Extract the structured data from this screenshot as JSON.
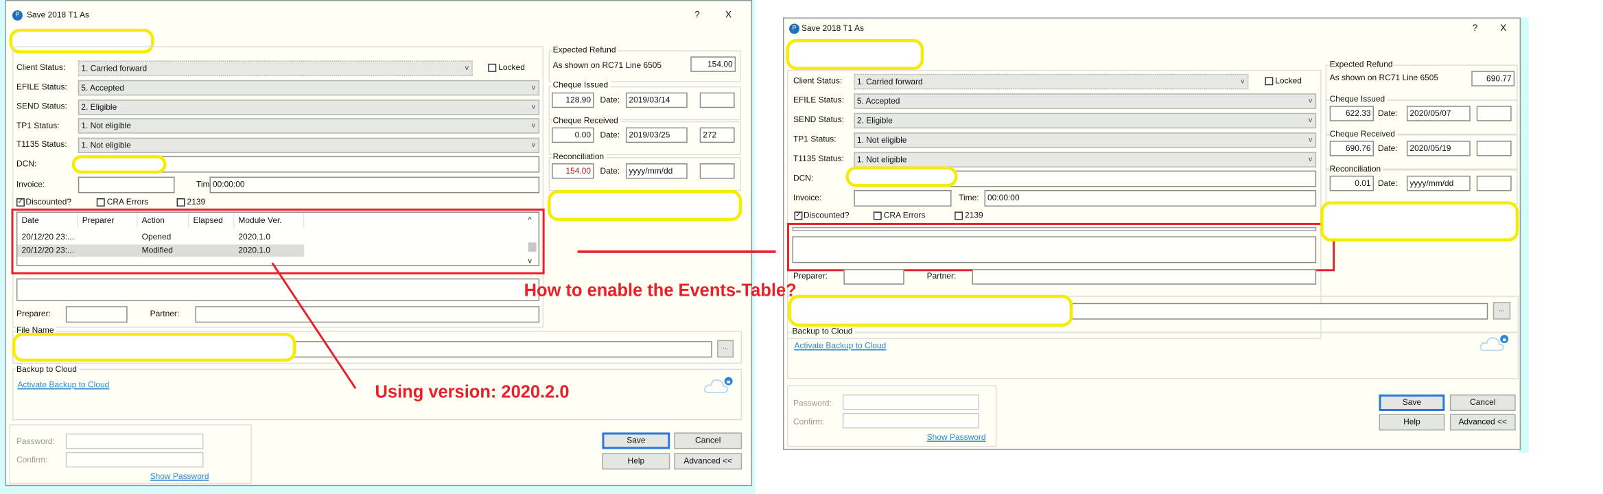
{
  "left_dialog": {
    "title": "Save 2018 T1 As",
    "help": "?",
    "close": "X",
    "client_status": {
      "label": "Client Status:",
      "value": "1. Carried forward"
    },
    "locked": "Locked",
    "efile_status": {
      "label": "EFILE Status:",
      "value": "5. Accepted"
    },
    "send_status": {
      "label": "SEND Status:",
      "value": "2. Eligible"
    },
    "tp1_status": {
      "label": "TP1 Status:",
      "value": "1. Not eligible"
    },
    "t1135_status": {
      "label": "T1135 Status:",
      "value": "1. Not eligible"
    },
    "dcn_label": "DCN:",
    "invoice_label": "Invoice:",
    "time_label": "Time:",
    "time_value": "00:00:00",
    "discounted": "Discounted?",
    "cra_errors": "CRA Errors",
    "form_2139": "2139",
    "events_table": {
      "columns": [
        "Date",
        "Preparer",
        "Action",
        "Elapsed",
        "Module Ver."
      ],
      "rows": [
        [
          "20/12/20 23:...",
          "",
          "Opened",
          "",
          "2020.1.0"
        ],
        [
          "20/12/20 23:...",
          "",
          "Modified",
          "",
          "2020.1.0"
        ]
      ]
    },
    "preparer_label": "Preparer:",
    "partner_label": "Partner:",
    "file_name_label": "File Name",
    "browse": "...",
    "backup_title": "Backup to Cloud",
    "backup_link": "Activate Backup to Cloud",
    "password_label": "Password:",
    "confirm_label": "Confirm:",
    "show_password": "Show Password",
    "buttons": {
      "save": "Save",
      "cancel": "Cancel",
      "help": "Help",
      "advanced": "Advanced <<"
    },
    "expected_refund": {
      "title": "Expected Refund",
      "line_label": "As shown on RC71 Line 6505",
      "value": "154.00"
    },
    "cheque_issued": {
      "title": "Cheque Issued",
      "amount": "128.90",
      "date_label": "Date:",
      "date": "2019/03/14",
      "extra": ""
    },
    "cheque_received": {
      "title": "Cheque Received",
      "amount": "0.00",
      "date_label": "Date:",
      "date": "2019/03/25",
      "extra": "272"
    },
    "reconciliation": {
      "title": "Reconciliation",
      "amount": "154.00",
      "date_label": "Date:",
      "date": "yyyy/mm/dd",
      "extra": ""
    }
  },
  "right_dialog": {
    "title": "Save 2018 T1 As",
    "help": "?",
    "close": "X",
    "client_status": {
      "label": "Client Status:",
      "value": "1. Carried forward"
    },
    "locked": "Locked",
    "efile_status": {
      "label": "EFILE Status:",
      "value": "5. Accepted"
    },
    "send_status": {
      "label": "SEND Status:",
      "value": "2. Eligible"
    },
    "tp1_status": {
      "label": "TP1 Status:",
      "value": "1. Not eligible"
    },
    "t1135_status": {
      "label": "T1135 Status:",
      "value": "1. Not eligible"
    },
    "dcn_label": "DCN:",
    "invoice_label": "Invoice:",
    "time_label": "Time:",
    "time_value": "00:00:00",
    "discounted": "Discounted?",
    "cra_errors": "CRA Errors",
    "form_2139": "2139",
    "preparer_label": "Preparer:",
    "partner_label": "Partner:",
    "browse": "...",
    "backup_title": "Backup to Cloud",
    "backup_link": "Activate Backup to Cloud",
    "password_label": "Password:",
    "confirm_label": "Confirm:",
    "show_password": "Show Password",
    "buttons": {
      "save": "Save",
      "cancel": "Cancel",
      "help": "Help",
      "advanced": "Advanced <<"
    },
    "expected_refund": {
      "title": "Expected Refund",
      "line_label": "As shown on RC71 Line 6505",
      "value": "690.77"
    },
    "cheque_issued": {
      "title": "Cheque Issued",
      "amount": "622.33",
      "date_label": "Date:",
      "date": "2020/05/07",
      "extra": ""
    },
    "cheque_received": {
      "title": "Cheque Received",
      "amount": "690.76",
      "date_label": "Date:",
      "date": "2020/05/19",
      "extra": ""
    },
    "reconciliation": {
      "title": "Reconciliation",
      "amount": "0.01",
      "date_label": "Date:",
      "date": "yyyy/mm/dd",
      "extra": ""
    }
  },
  "annotations": {
    "question": "How to enable the Events-Table?",
    "version_note": "Using version: 2020.2.0",
    "color": "#e8202a"
  }
}
